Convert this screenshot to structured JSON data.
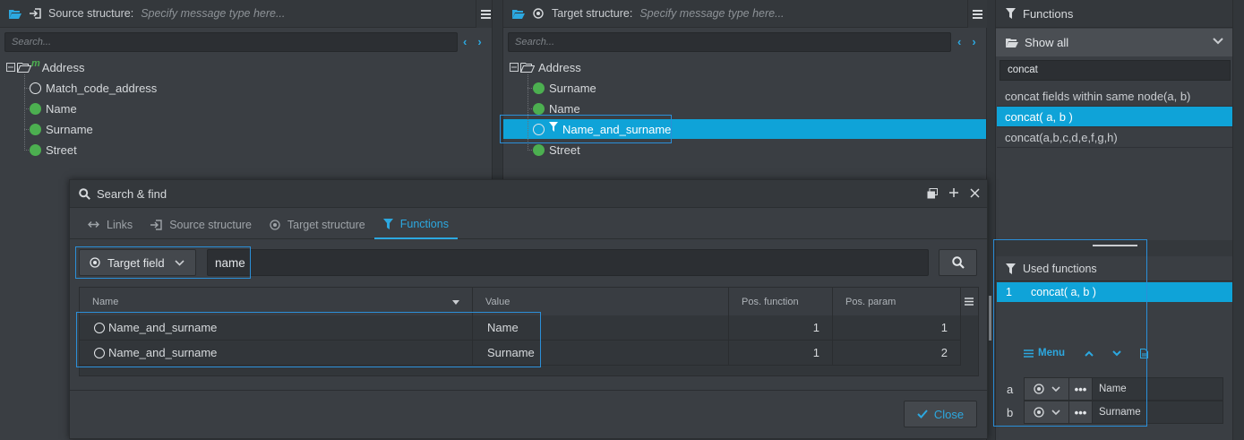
{
  "source": {
    "title": "Source structure:",
    "placeholder": "Specify message type here...",
    "search_placeholder": "Search...",
    "root": "Address",
    "items": [
      "Match_code_address",
      "Name",
      "Surname",
      "Street"
    ]
  },
  "target": {
    "title": "Target structure:",
    "placeholder": "Specify message type here...",
    "search_placeholder": "Search...",
    "root": "Address",
    "items": [
      "Surname",
      "Name",
      "Name_and_surname",
      "Street"
    ]
  },
  "functions": {
    "title": "Functions",
    "filter": "Show all",
    "search_value": "concat",
    "items": [
      "concat fields within same node(a, b)",
      "concat( a, b )",
      "concat(a,b,c,d,e,f,g,h)"
    ]
  },
  "used": {
    "title": "Used functions",
    "row_index": "1",
    "row_name": "concat( a, b )",
    "menu_label": "Menu",
    "params": [
      {
        "key": "a",
        "value": "Name"
      },
      {
        "key": "b",
        "value": "Surname"
      }
    ]
  },
  "dialog": {
    "title": "Search & find",
    "tabs": [
      "Links",
      "Source structure",
      "Target structure",
      "Functions"
    ],
    "field_type": "Target field",
    "query": "name",
    "columns": [
      "Name",
      "Value",
      "Pos. function",
      "Pos. param"
    ],
    "rows": [
      {
        "name": "Name_and_surname",
        "value": "Name",
        "pos_function": "1",
        "pos_param": "1"
      },
      {
        "name": "Name_and_surname",
        "value": "Surname",
        "pos_function": "1",
        "pos_param": "2"
      }
    ],
    "close_label": "Close"
  },
  "colors": {
    "accent": "#0fa3d8",
    "node_green": "#4caf50",
    "bg": "#3a3e43"
  }
}
